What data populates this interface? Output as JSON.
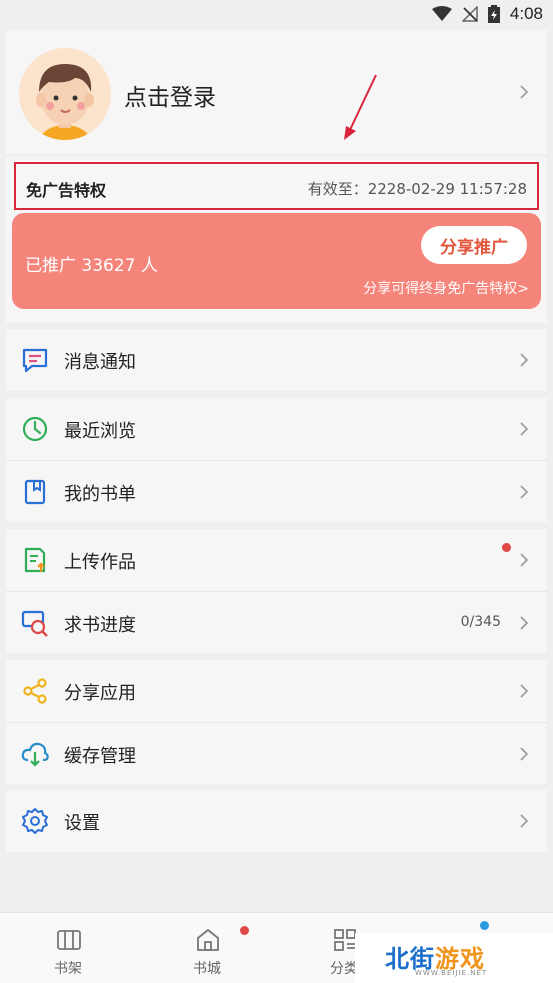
{
  "status_bar": {
    "time": "4:08"
  },
  "profile": {
    "login_label": "点击登录"
  },
  "ad_free": {
    "title": "免广告特权",
    "valid_until": "有效至：2228-02-29 11:57:28"
  },
  "promotion": {
    "count_text": "已推广 33627 人",
    "share_button": "分享推广",
    "note": "分享可得终身免广告特权>"
  },
  "menu": {
    "notifications": "消息通知",
    "recent": "最近浏览",
    "booklist": "我的书单",
    "upload": "上传作品",
    "request_progress": "求书进度",
    "request_progress_value": "0/345",
    "share_app": "分享应用",
    "cache": "缓存管理",
    "settings": "设置"
  },
  "bottom_nav": {
    "bookshelf": "书架",
    "store": "书城",
    "category": "分类"
  },
  "watermark": {
    "text_a": "北街",
    "text_b": "游戏",
    "url": "WWW.BEIJIE.NET"
  },
  "colors": {
    "accent_red": "#d8263a",
    "promo_bg": "#f5847b",
    "badge": "#e04848"
  }
}
